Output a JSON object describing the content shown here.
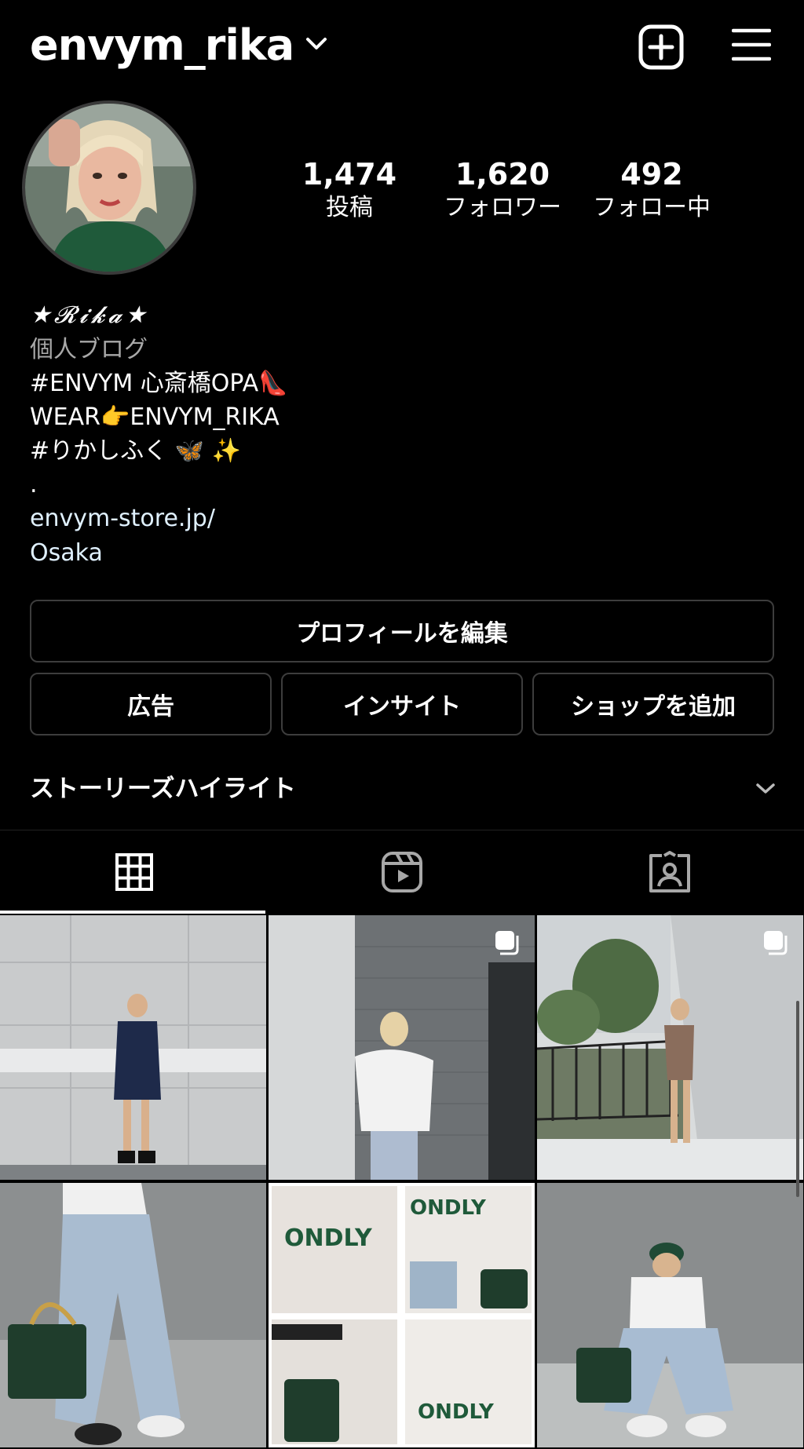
{
  "header": {
    "username": "envym_rika"
  },
  "stats": [
    {
      "value": "1,474",
      "label": "投稿"
    },
    {
      "value": "1,620",
      "label": "フォロワー"
    },
    {
      "value": "492",
      "label": "フォロー中"
    }
  ],
  "bio": {
    "name": "★𝓡𝓲𝓴𝓪★",
    "category": "個人ブログ",
    "lines": [
      "#ENVYM 心斎橋OPA👠",
      "WEAR👉ENVYM_RIKA",
      "#りかしふく 🦋 ✨",
      "."
    ],
    "link": "envym-store.jp/",
    "location": "Osaka"
  },
  "buttons": {
    "edit_profile": "プロフィールを編集",
    "ad": "広告",
    "insights": "インサイト",
    "add_shop": "ショップを追加"
  },
  "highlights": {
    "label": "ストーリーズハイライト"
  },
  "tabs": [
    {
      "icon": "grid-icon",
      "active": true
    },
    {
      "icon": "reels-icon",
      "active": false
    },
    {
      "icon": "tagged-icon",
      "active": false
    }
  ],
  "posts": [
    {
      "multi": false
    },
    {
      "multi": true
    },
    {
      "multi": true
    },
    {
      "multi": false
    },
    {
      "multi": false
    },
    {
      "multi": false
    }
  ],
  "colors": {
    "background": "#000000",
    "secondary_text": "#a8a8a8",
    "link": "#e0f1ff",
    "button_border": "#3d3d3d"
  }
}
